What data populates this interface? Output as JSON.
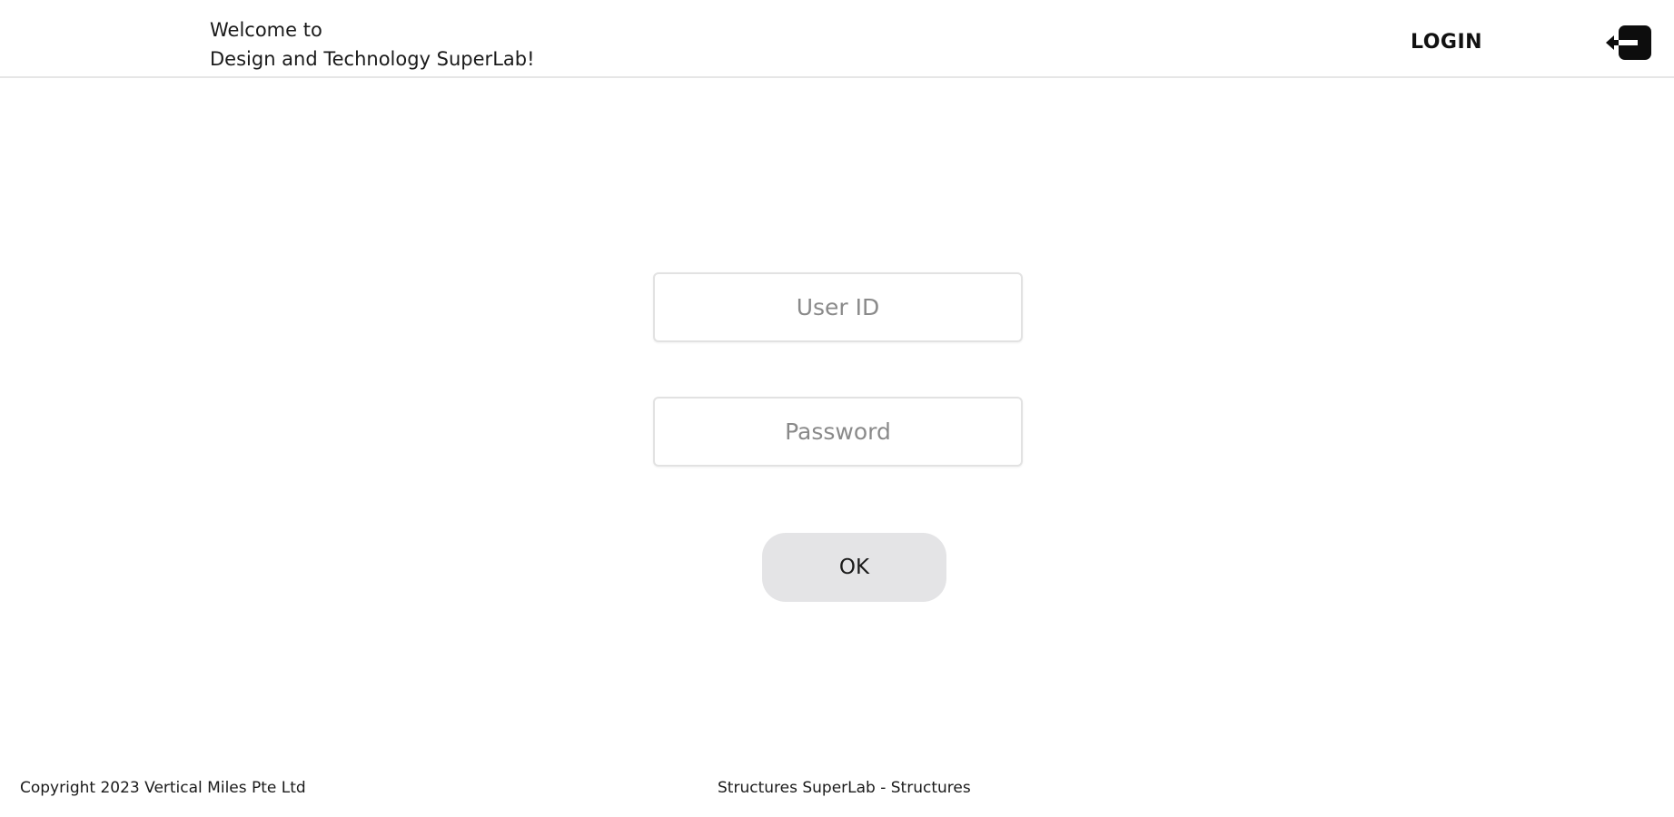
{
  "header": {
    "welcome_line1": "Welcome to",
    "welcome_line2": "Design and Technology SuperLab!",
    "login_label": "LOGIN",
    "login_icon": "sign-in-icon"
  },
  "form": {
    "user_id": {
      "value": "",
      "placeholder": "User ID"
    },
    "password": {
      "value": "",
      "placeholder": "Password"
    },
    "ok_label": "OK"
  },
  "footer": {
    "copyright": "Copyright 2023 Vertical Miles Pte Ltd",
    "app_name": "Structures SuperLab - Structures"
  },
  "colors": {
    "background": "#ffffff",
    "button_background": "#e4e4e6",
    "border": "#e2e2e2",
    "text": "#111111"
  }
}
